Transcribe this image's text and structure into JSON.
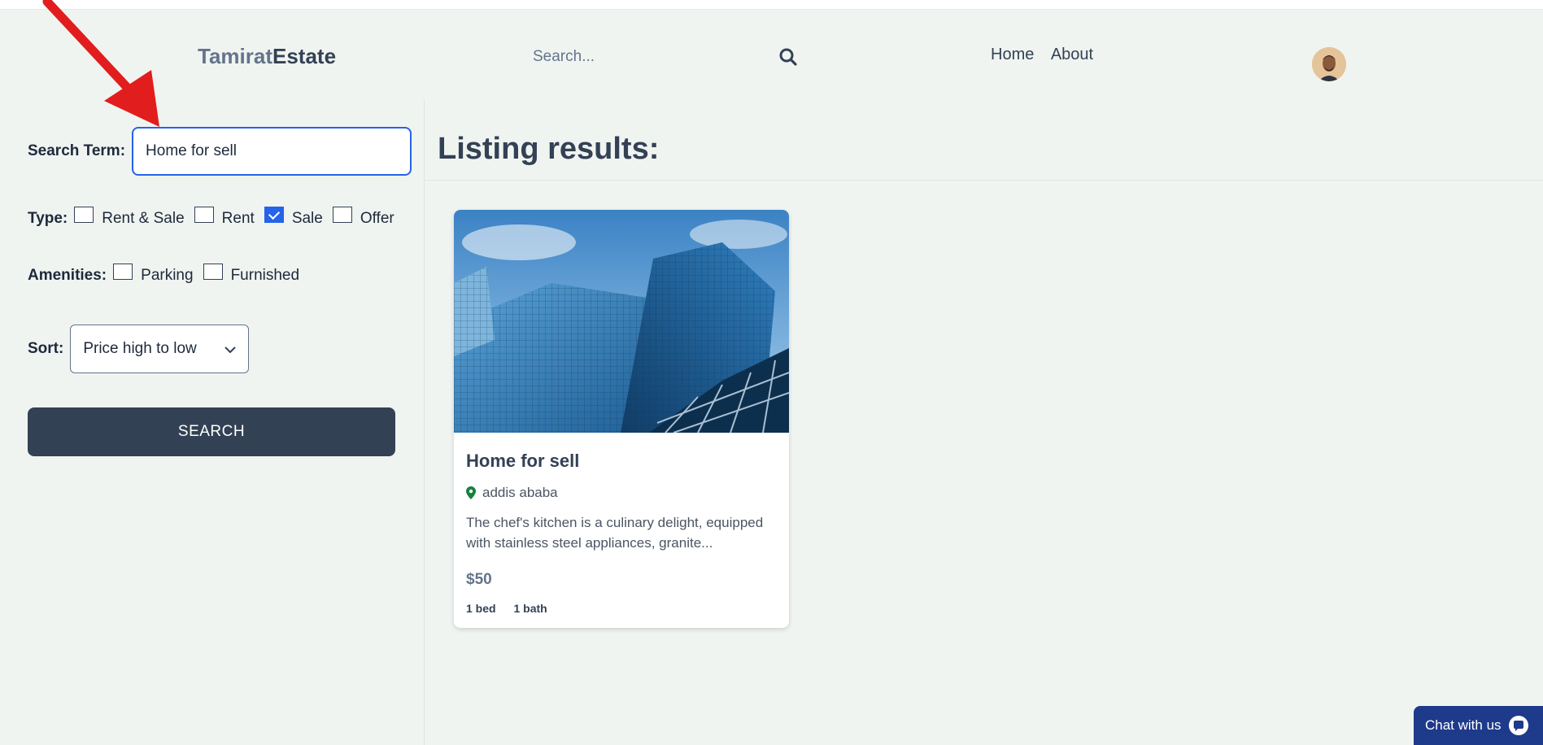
{
  "header": {
    "logo_part1": "Tamirat",
    "logo_part2": "Estate",
    "search_placeholder": "Search...",
    "nav": [
      "Home",
      "About"
    ]
  },
  "filters": {
    "search_term_label": "Search Term:",
    "search_term_value": "Home for sell",
    "type_label": "Type:",
    "type_options": [
      {
        "label": "Rent & Sale",
        "checked": false
      },
      {
        "label": "Rent",
        "checked": false
      },
      {
        "label": "Sale",
        "checked": true
      },
      {
        "label": "Offer",
        "checked": false
      }
    ],
    "amenities_label": "Amenities:",
    "amenities_options": [
      {
        "label": "Parking",
        "checked": false
      },
      {
        "label": "Furnished",
        "checked": false
      }
    ],
    "sort_label": "Sort:",
    "sort_value": "Price high to low",
    "search_button": "SEARCH"
  },
  "results": {
    "title": "Listing results:",
    "listings": [
      {
        "title": "Home for sell",
        "location": "addis ababa",
        "description_line1": "The chef's kitchen is a culinary delight, equipped",
        "description_line2": "with stainless steel appliances, granite...",
        "price": "$50",
        "beds": "1 bed",
        "baths": "1 bath"
      }
    ]
  },
  "chat": {
    "label": "Chat with us"
  },
  "colors": {
    "accent": "#2563eb",
    "dark": "#334155",
    "chat": "#1e3a8a",
    "annotation_arrow": "#e11d1d"
  }
}
